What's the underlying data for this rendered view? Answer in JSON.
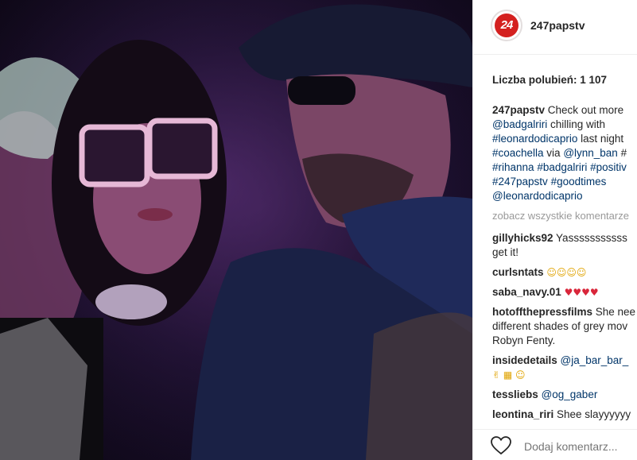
{
  "post": {
    "username": "247papstv",
    "avatar_text": "24",
    "likes_text": "Liczba polubień: 1 107",
    "caption": {
      "user": "247papstv",
      "lines": [
        [
          {
            "t": "text",
            "v": "Check out more"
          }
        ],
        [
          {
            "t": "tag",
            "v": "@badgalriri"
          },
          {
            "t": "text",
            "v": " chilling with"
          }
        ],
        [
          {
            "t": "tag",
            "v": "#leonardodicaprio"
          },
          {
            "t": "text",
            "v": " last night"
          }
        ],
        [
          {
            "t": "tag",
            "v": "#coachella"
          },
          {
            "t": "text",
            "v": " via "
          },
          {
            "t": "tag",
            "v": "@lynn_ban"
          },
          {
            "t": "text",
            "v": " #"
          }
        ],
        [
          {
            "t": "tag",
            "v": "#rihanna"
          },
          {
            "t": "text",
            "v": " "
          },
          {
            "t": "tag",
            "v": "#badgalriri"
          },
          {
            "t": "text",
            "v": " "
          },
          {
            "t": "tag",
            "v": "#positiv"
          }
        ],
        [
          {
            "t": "tag",
            "v": "#247papstv"
          },
          {
            "t": "text",
            "v": " "
          },
          {
            "t": "tag",
            "v": "#goodtimes"
          }
        ],
        [
          {
            "t": "tag",
            "v": "@leonardodicaprio"
          }
        ]
      ]
    },
    "view_all": "zobacz wszystkie komentarze",
    "comments": [
      {
        "user": "gillyhicks92",
        "lines": [
          [
            {
              "t": "text",
              "v": " Yasssssssssss"
            }
          ],
          [
            {
              "t": "text",
              "v": "get it!"
            }
          ]
        ]
      },
      {
        "user": "curlsntats",
        "lines": [
          [
            {
              "t": "emoji",
              "v": " ☺☺☺☺"
            }
          ]
        ]
      },
      {
        "user": "saba_navy.01",
        "lines": [
          [
            {
              "t": "emojired",
              "v": " ♥♥♥♥"
            }
          ]
        ]
      },
      {
        "user": "hotoffthepressfilms",
        "lines": [
          [
            {
              "t": "text",
              "v": " She nee"
            }
          ],
          [
            {
              "t": "text",
              "v": "different shades of grey mov"
            }
          ],
          [
            {
              "t": "text",
              "v": "Robyn Fenty."
            }
          ]
        ]
      },
      {
        "user": "insidedetails",
        "lines": [
          [
            {
              "t": "text",
              "v": " "
            },
            {
              "t": "tag",
              "v": "@ja_bar_bar_"
            }
          ],
          [
            {
              "t": "emoji",
              "v": "✌ ▦ ☺"
            }
          ]
        ]
      },
      {
        "user": "tessliebs",
        "lines": [
          [
            {
              "t": "text",
              "v": " "
            },
            {
              "t": "tag",
              "v": "@og_gaber"
            }
          ]
        ]
      },
      {
        "user": "leontina_riri",
        "lines": [
          [
            {
              "t": "text",
              "v": " Shee slayyyyyy"
            }
          ]
        ]
      }
    ],
    "add_comment_placeholder": "Dodaj komentarz..."
  },
  "colors": {
    "link": "#003569",
    "username": "#262626",
    "muted": "#999999",
    "brand": "#d4201f"
  },
  "icons": {
    "like": "heart-outline-icon"
  }
}
